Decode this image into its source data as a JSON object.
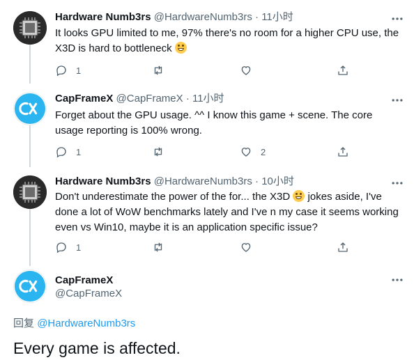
{
  "tweets": [
    {
      "name": "Hardware Numb3rs",
      "handle": "@HardwareNumb3rs",
      "time": "11小时",
      "text_before_emoji": "It looks GPU limited to me, 97% there's no room for a higher CPU use, the X3D is hard to bottleneck ",
      "text_after_emoji": "",
      "replies": "1",
      "likes": ""
    },
    {
      "name": "CapFrameX",
      "handle": "@CapFrameX",
      "time": "11小时",
      "text_before_emoji": "Forget about the GPU usage. ^^ I know this game + scene. The core usage reporting is 100% wrong.",
      "text_after_emoji": "",
      "replies": "1",
      "likes": "2"
    },
    {
      "name": "Hardware Numb3rs",
      "handle": "@HardwareNumb3rs",
      "time": "10小时",
      "text_before_emoji": "Don't underestimate the power of the for... the X3D ",
      "text_after_emoji": " jokes aside, I've done a lot of WoW benchmarks lately and I've n my case it seems working even vs Win10, maybe it is an application specific issue?",
      "replies": "1",
      "likes": ""
    }
  ],
  "main_tweet": {
    "name": "CapFrameX",
    "handle": "@CapFrameX",
    "reply_prefix": "回复",
    "reply_to": "@HardwareNumb3rs",
    "text": "Every game is affected."
  },
  "separator": "·",
  "colors": {
    "brand_blue": "#1d9bf0",
    "text_primary": "#0f1419",
    "text_secondary": "#536471",
    "thread_line": "#cfd9de",
    "capframex_teal": "#2ab4f0"
  },
  "icons": {
    "reply": "speech-bubble-icon",
    "retweet": "retweet-icon",
    "like": "heart-icon",
    "share": "share-icon",
    "more": "more-horizontal-icon"
  }
}
